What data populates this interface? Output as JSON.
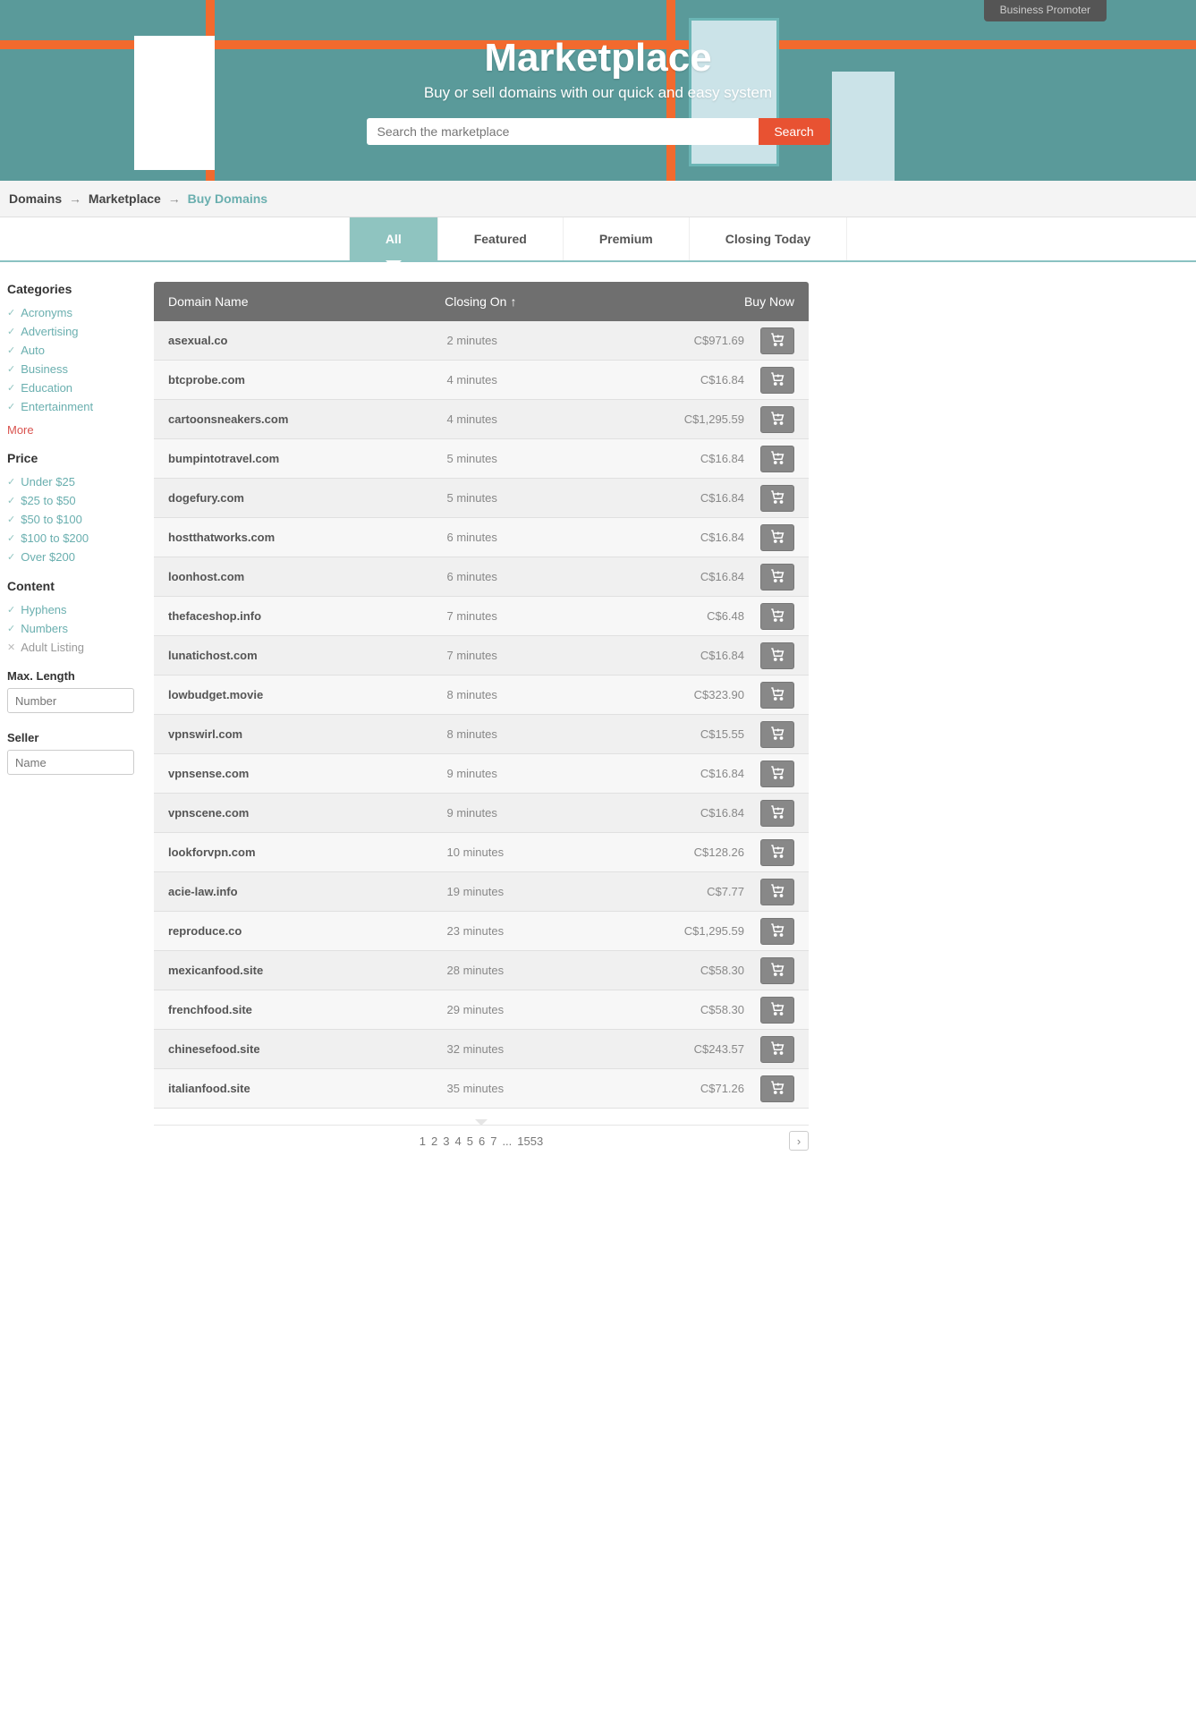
{
  "promo_tab": "Business Promoter",
  "hero": {
    "title": "Marketplace",
    "subtitle": "Buy or sell domains with our quick and easy system",
    "search_placeholder": "Search the marketplace",
    "search_button": "Search"
  },
  "breadcrumb": {
    "a": "Domains",
    "b": "Marketplace",
    "c": "Buy Domains",
    "arrow": "→"
  },
  "tabs": [
    "All",
    "Featured",
    "Premium",
    "Closing Today"
  ],
  "selected_tab": 0,
  "sidebar": {
    "categories_head": "Categories",
    "categories": [
      "Acronyms",
      "Advertising",
      "Auto",
      "Business",
      "Education",
      "Entertainment"
    ],
    "more": "More",
    "price_head": "Price",
    "prices": [
      "Under $25",
      "$25 to $50",
      "$50 to $100",
      "$100 to $200",
      "Over $200"
    ],
    "content_head": "Content",
    "content_items": [
      {
        "label": "Hyphens",
        "on": true
      },
      {
        "label": "Numbers",
        "on": true
      },
      {
        "label": "Adult Listing",
        "on": false
      }
    ],
    "maxlen_label": "Max. Length",
    "maxlen_placeholder": "Number",
    "seller_label": "Seller",
    "seller_placeholder": "Name"
  },
  "table": {
    "headers": {
      "name": "Domain Name",
      "closing": "Closing On",
      "sort": "↑",
      "buy": "Buy Now"
    },
    "rows": [
      {
        "name": "asexual.co",
        "closing": "2 minutes",
        "price": "C$971.69"
      },
      {
        "name": "btcprobe.com",
        "closing": "4 minutes",
        "price": "C$16.84"
      },
      {
        "name": "cartoonsneakers.com",
        "closing": "4 minutes",
        "price": "C$1,295.59"
      },
      {
        "name": "bumpintotravel.com",
        "closing": "5 minutes",
        "price": "C$16.84"
      },
      {
        "name": "dogefury.com",
        "closing": "5 minutes",
        "price": "C$16.84"
      },
      {
        "name": "hostthatworks.com",
        "closing": "6 minutes",
        "price": "C$16.84"
      },
      {
        "name": "loonhost.com",
        "closing": "6 minutes",
        "price": "C$16.84"
      },
      {
        "name": "thefaceshop.info",
        "closing": "7 minutes",
        "price": "C$6.48"
      },
      {
        "name": "lunatichost.com",
        "closing": "7 minutes",
        "price": "C$16.84"
      },
      {
        "name": "lowbudget.movie",
        "closing": "8 minutes",
        "price": "C$323.90"
      },
      {
        "name": "vpnswirl.com",
        "closing": "8 minutes",
        "price": "C$15.55"
      },
      {
        "name": "vpnsense.com",
        "closing": "9 minutes",
        "price": "C$16.84"
      },
      {
        "name": "vpnscene.com",
        "closing": "9 minutes",
        "price": "C$16.84"
      },
      {
        "name": "lookforvpn.com",
        "closing": "10 minutes",
        "price": "C$128.26"
      },
      {
        "name": "acie-law.info",
        "closing": "19 minutes",
        "price": "C$7.77"
      },
      {
        "name": "reproduce.co",
        "closing": "23 minutes",
        "price": "C$1,295.59"
      },
      {
        "name": "mexicanfood.site",
        "closing": "28 minutes",
        "price": "C$58.30"
      },
      {
        "name": "frenchfood.site",
        "closing": "29 minutes",
        "price": "C$58.30"
      },
      {
        "name": "chinesefood.site",
        "closing": "32 minutes",
        "price": "C$243.57"
      },
      {
        "name": "italianfood.site",
        "closing": "35 minutes",
        "price": "C$71.26"
      }
    ]
  },
  "pager": {
    "pages": [
      "1",
      "2",
      "3",
      "4",
      "5",
      "6",
      "7",
      "...",
      "1553"
    ]
  }
}
